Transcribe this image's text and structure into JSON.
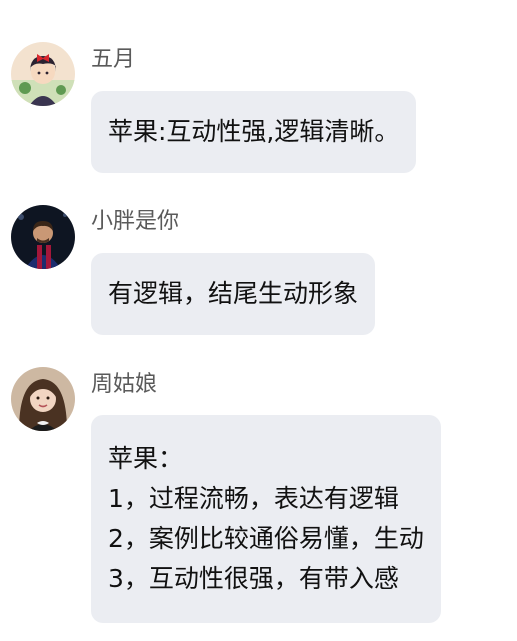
{
  "messages": [
    {
      "author": "五月",
      "avatar_icon": "anime-girl-avatar-icon",
      "lines": [
        "苹果:互动性强,逻辑清晰。"
      ]
    },
    {
      "author": "小胖是你",
      "avatar_icon": "soccer-player-avatar-icon",
      "lines": [
        "有逻辑，结尾生动形象"
      ]
    },
    {
      "author": "周姑娘",
      "avatar_icon": "woman-photo-avatar-icon",
      "lines": [
        "苹果：",
        "1，过程流畅，表达有逻辑",
        "2，案例比较通俗易懂，生动",
        "3，互动性很强，有带入感"
      ]
    }
  ],
  "colors": {
    "bubble_bg": "#ebedf2",
    "name_text": "#5a5a5a",
    "message_text": "#111111"
  }
}
